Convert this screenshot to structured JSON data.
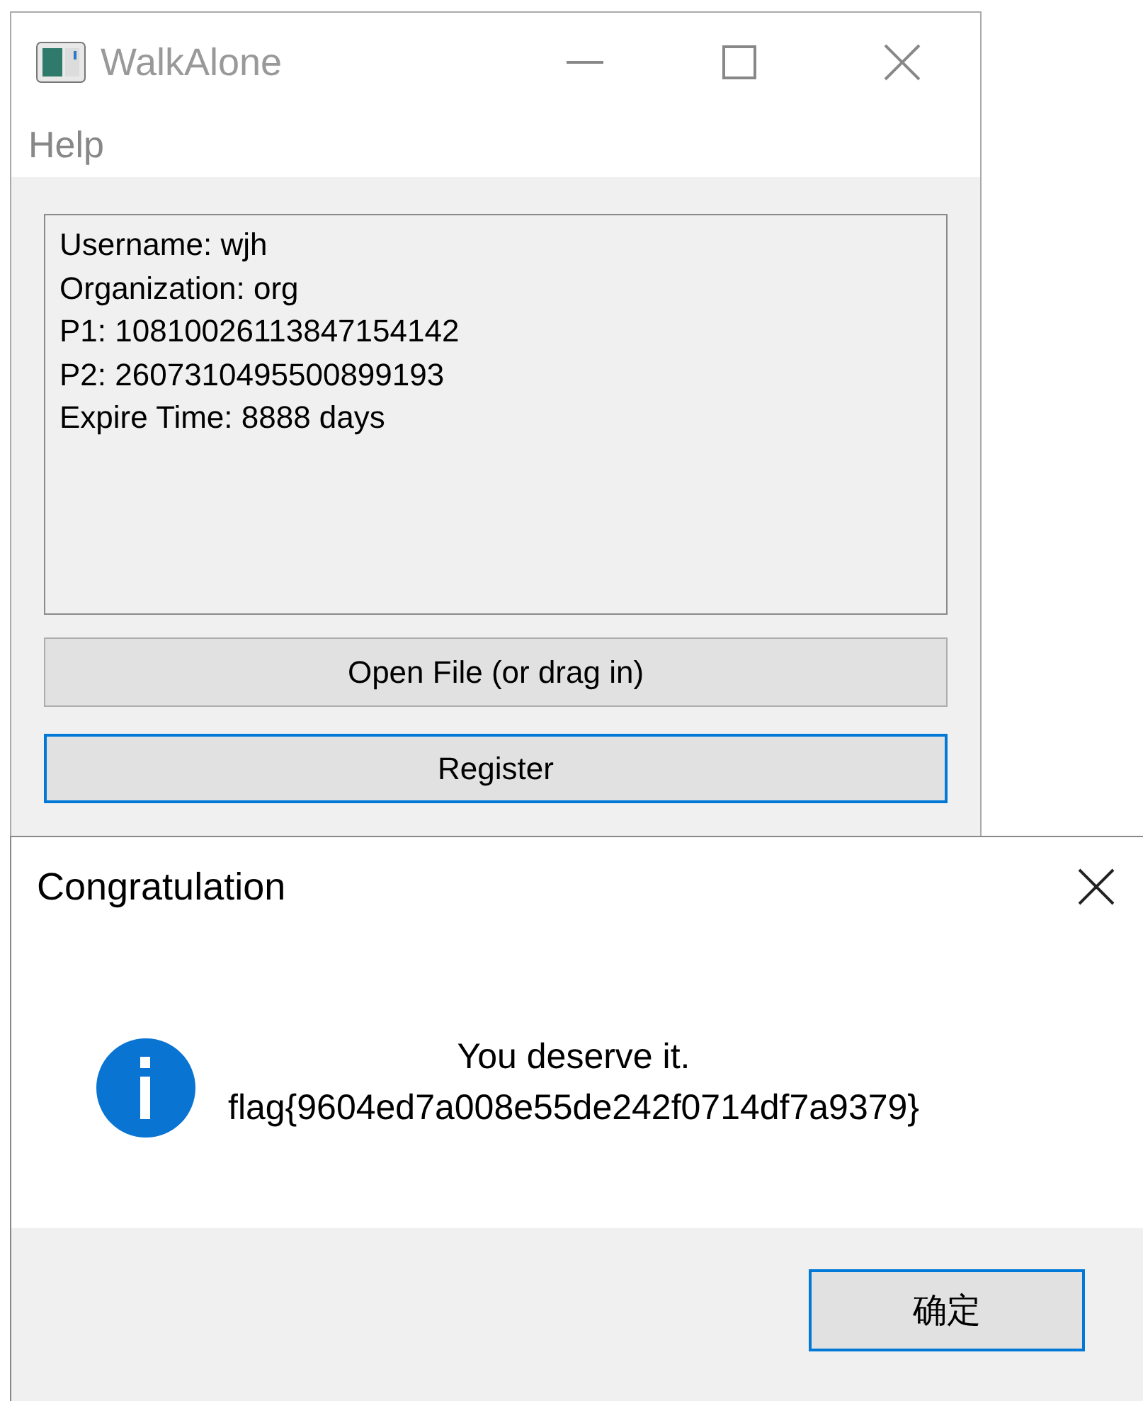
{
  "main_window": {
    "title": "WalkAlone",
    "menu": [
      "Help"
    ],
    "info_lines": [
      "Username: wjh",
      "Organization: org",
      "P1: 10810026113847154142",
      "P2: 2607310495500899193",
      "Expire Time: 8888 days"
    ],
    "buttons": [
      {
        "label": "Open File (or drag in)",
        "focused": false
      },
      {
        "label": "Register",
        "focused": true
      }
    ]
  },
  "dialog": {
    "title": "Congratulation",
    "message": [
      "You deserve it.",
      "flag{9604ed7a008e55de242f0714df7a9379}"
    ],
    "buttons": [
      {
        "label": "确定",
        "focused": true
      }
    ]
  }
}
